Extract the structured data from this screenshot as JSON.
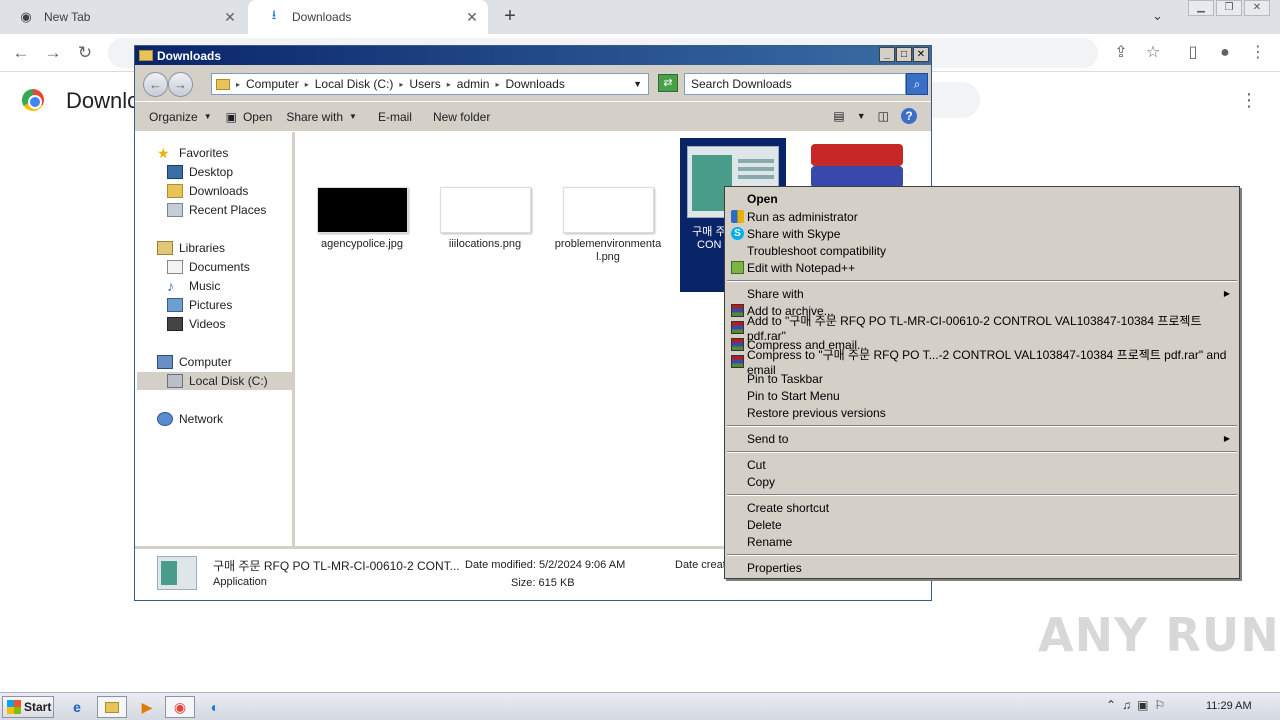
{
  "browser": {
    "tabs": [
      {
        "title": "New Tab",
        "icon": "chrome-icon"
      },
      {
        "title": "Downloads",
        "icon": "download-icon"
      }
    ],
    "page_title": "Downlo"
  },
  "explorer": {
    "title": "Downloads",
    "path": [
      "Computer",
      "Local Disk (C:)",
      "Users",
      "admin",
      "Downloads"
    ],
    "search_placeholder": "Search Downloads",
    "commands": {
      "organize": "Organize",
      "open": "Open",
      "share_with": "Share with",
      "email": "E-mail",
      "new_folder": "New folder"
    },
    "nav": {
      "favorites": "Favorites",
      "desktop": "Desktop",
      "downloads": "Downloads",
      "recent": "Recent Places",
      "libraries": "Libraries",
      "documents": "Documents",
      "music": "Music",
      "pictures": "Pictures",
      "videos": "Videos",
      "computer": "Computer",
      "local_disk": "Local Disk (C:)",
      "network": "Network"
    },
    "files": [
      {
        "name": "agencypolice.jpg"
      },
      {
        "name": "iiilocations.png"
      },
      {
        "name": "problemenvironmental.png"
      },
      {
        "name": "구매 주 TL-MR-C CON VAL1038"
      }
    ],
    "details": {
      "name": "구매 주문 RFQ PO TL-MR-CI-00610-2 CONT...",
      "type": "Application",
      "modified_label": "Date modified:",
      "modified": "5/2/2024 9:06 AM",
      "size_label": "Size:",
      "size": "615 KB",
      "created_label": "Date creat"
    }
  },
  "context_menu": {
    "open": "Open",
    "run_admin": "Run as administrator",
    "share_skype": "Share with Skype",
    "troubleshoot": "Troubleshoot compatibility",
    "edit_notepad": "Edit with Notepad++",
    "share_with": "Share with",
    "add_archive": "Add to archive...",
    "add_to_rar": "Add to \"구매 주문 RFQ PO TL-MR-CI-00610-2 CONTROL VAL103847-10384 프로젝트 pdf.rar\"",
    "compress_email": "Compress and email...",
    "compress_to_rar_email": "Compress to \"구매 주문 RFQ PO T...-2 CONTROL VAL103847-10384 프로젝트 pdf.rar\" and email",
    "pin_taskbar": "Pin to Taskbar",
    "pin_start": "Pin to Start Menu",
    "restore": "Restore previous versions",
    "send_to": "Send to",
    "cut": "Cut",
    "copy": "Copy",
    "create_shortcut": "Create shortcut",
    "delete": "Delete",
    "rename": "Rename",
    "properties": "Properties"
  },
  "taskbar": {
    "start": "Start",
    "clock": "11:29 AM"
  },
  "watermark": "ANY RUN"
}
